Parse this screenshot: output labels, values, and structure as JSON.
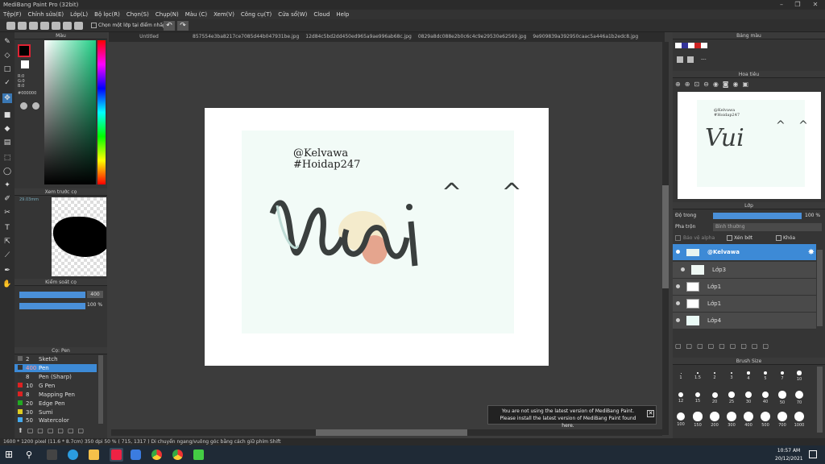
{
  "app": {
    "title": "MediBang Paint Pro (32bit)"
  },
  "menu": [
    "Tệp(F)",
    "Chỉnh sửa(E)",
    "Lớp(L)",
    "Bộ lọc(R)",
    "Chọn(S)",
    "Chụp(N)",
    "Màu (C)",
    "Xem(V)",
    "Công cụ(T)",
    "Cửa sổ(W)",
    "Cloud",
    "Help"
  ],
  "toolbar": {
    "pick_layer_label": "Chọn một lớp tại điểm nhấp"
  },
  "tabs": [
    "Untitled",
    "857554e3ba8217ce7085d44b047931be.jpg",
    "12d84c5bd2dd450ed965a9ae996ab68c.jpg",
    "0829a8dc088e2b0c6c4c9e29530e62569.jpg",
    "9e909839a392950caac5a446a1b2edc8.jpg"
  ],
  "color_panel": {
    "title": "Màu",
    "r": "R:0",
    "g": "G:0",
    "b": "B:0",
    "hex": "#000000"
  },
  "preview_panel": {
    "title": "Xem trước cọ",
    "size": "29.03mm"
  },
  "brush_control": {
    "title": "Kiểm soát cọ",
    "size_value": "400",
    "opacity_value": "100 %"
  },
  "brush_panel": {
    "title": "Cọ: Pen",
    "items": [
      {
        "num": "2",
        "name": "Sketch"
      },
      {
        "num": "400",
        "name": "Pen"
      },
      {
        "num": "8",
        "name": "Pen (Sharp)"
      },
      {
        "num": "10",
        "name": "G Pen"
      },
      {
        "num": "8",
        "name": "Mapping Pen"
      },
      {
        "num": "20",
        "name": "Edge Pen"
      },
      {
        "num": "30",
        "name": "Sumi"
      },
      {
        "num": "50",
        "name": "Watercolor"
      }
    ]
  },
  "art": {
    "line1": "@Kelvawa",
    "line2": "#Hoidap247",
    "caret": "^ ^"
  },
  "palette_panel": {
    "title": "Bảng màu",
    "dash": "---"
  },
  "nav_panel": {
    "title": "Hoa tiêu"
  },
  "layer_panel": {
    "title": "Lớp",
    "opacity_label": "Độ trong",
    "opacity_value": "100 %",
    "blend_label": "Pha trộn",
    "blend_value": "Bình thường",
    "protect_alpha": "Bảo vệ alpha",
    "clip": "Xén bớt",
    "lock": "Khóa",
    "layers": [
      "@Kelvawa",
      "Lớp3",
      "Lớp1",
      "Lớp1",
      "Lớp4"
    ]
  },
  "brush_size_panel": {
    "title": "Brush Size",
    "sizes": [
      "1",
      "1.5",
      "2",
      "3",
      "4",
      "5",
      "7",
      "10",
      "12",
      "15",
      "20",
      "25",
      "30",
      "40",
      "50",
      "70",
      "100",
      "150",
      "200",
      "300",
      "400",
      "500",
      "700",
      "1000"
    ]
  },
  "notice": {
    "line1": "You are not using the latest version of MediBang Paint.",
    "line2": "Please install the latest version of MediBang Paint found here."
  },
  "status": {
    "text": "1600 * 1200 pixel   (11.6 * 8.7cm)   350 dpi   50 %   ( 715, 1317 )   Di chuyển ngang/vuông góc bằng cách giữ phím Shift"
  },
  "clock": {
    "time": "10:57 AM",
    "date": "20/12/2021"
  }
}
